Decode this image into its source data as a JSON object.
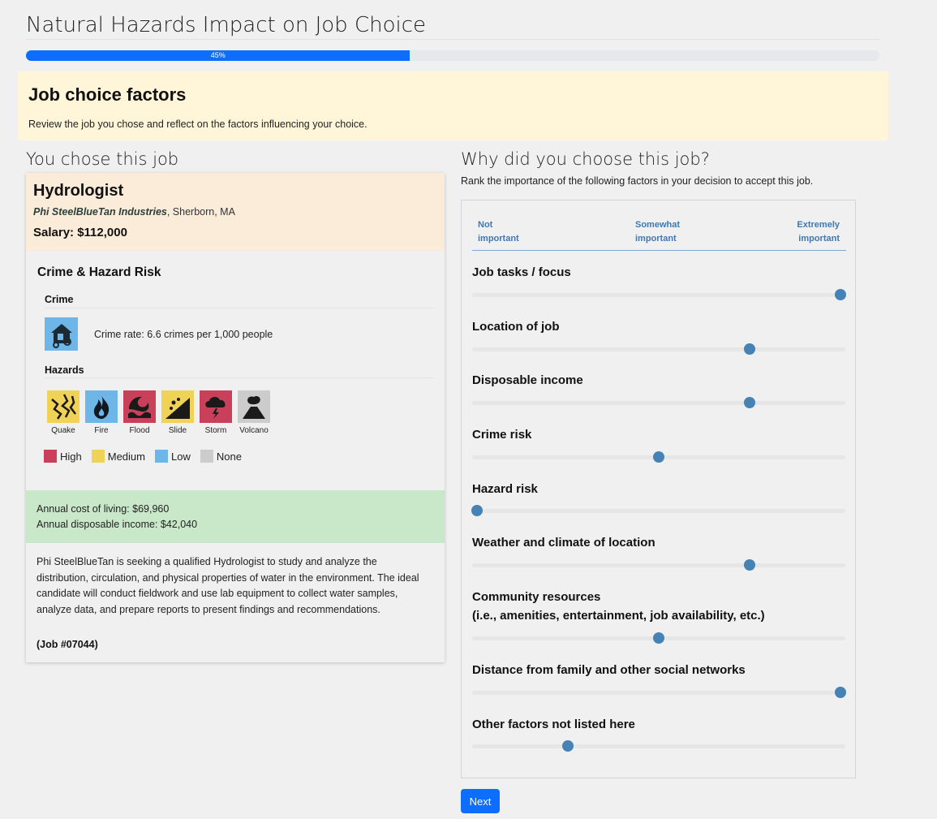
{
  "page": {
    "title": "Natural Hazards Impact on Job Choice"
  },
  "progress": {
    "value": 45,
    "label": "45%"
  },
  "banner": {
    "heading": "Job choice factors",
    "text": "Review the job you chose and reflect on the factors influencing your choice."
  },
  "job": {
    "section_heading": "You chose this job",
    "title": "Hydrologist",
    "company": "Phi SteelBlueTan Industries",
    "location": ", Sherborn, MA",
    "salary": "Salary: $112,000",
    "risk_heading": "Crime & Hazard Risk",
    "crime_heading": "Crime",
    "crime_icon": "house-burglary-icon",
    "crime_text": "Crime rate: 6.6 crimes per 1,000 people",
    "hazards_heading": "Hazards",
    "hazards": [
      {
        "label": "Quake",
        "level": "Medium",
        "icon": "earthquake-icon"
      },
      {
        "label": "Fire",
        "level": "Low",
        "icon": "fire-icon"
      },
      {
        "label": "Flood",
        "level": "High",
        "icon": "flood-wave-icon"
      },
      {
        "label": "Slide",
        "level": "Medium",
        "icon": "landslide-icon"
      },
      {
        "label": "Storm",
        "level": "High",
        "icon": "storm-cloud-icon"
      },
      {
        "label": "Volcano",
        "level": "None",
        "icon": "volcano-icon"
      }
    ],
    "legend": [
      {
        "label": "High",
        "color": "#c9405a"
      },
      {
        "label": "Medium",
        "color": "#f0d256"
      },
      {
        "label": "Low",
        "color": "#6fb6e8"
      },
      {
        "label": "None",
        "color": "#cccccc"
      }
    ],
    "cost_of_living": "Annual cost of living: $69,960",
    "disposable_income": "Annual disposable income: $42,040",
    "description": "Phi SteelBlueTan is seeking a qualified Hydrologist to study and analyze the distribution, circulation, and physical properties of water in the environment. The ideal candidate will conduct fieldwork and use lab equipment to collect water samples, analyze data, and prepare reports to present findings and recommendations.",
    "job_id": "(Job #07044)"
  },
  "ranking": {
    "heading": "Why did you choose this job?",
    "instructions": "Rank the importance of the following factors in your decision to accept this job.",
    "scale": {
      "low_line1": "Not",
      "low_line2": "important",
      "mid_line1": "Somewhat",
      "mid_line2": "important",
      "high_line1": "Extremely",
      "high_line2": "important"
    },
    "factors": [
      {
        "label": "Job tasks / focus",
        "label2": "",
        "value": 1.0
      },
      {
        "label": "Location of job",
        "label2": "",
        "value": 0.75
      },
      {
        "label": "Disposable income",
        "label2": "",
        "value": 0.75
      },
      {
        "label": "Crime risk",
        "label2": "",
        "value": 0.5
      },
      {
        "label": "Hazard risk",
        "label2": "",
        "value": 0.0
      },
      {
        "label": "Weather and climate of location",
        "label2": "",
        "value": 0.75
      },
      {
        "label": "Community resources",
        "label2": "(i.e., amenities, entertainment, job availability, etc.)",
        "value": 0.5
      },
      {
        "label": "Distance from family and other social networks",
        "label2": "",
        "value": 1.0
      },
      {
        "label": "Other factors not listed here",
        "label2": "",
        "value": 0.25
      }
    ],
    "slider_color": "#4682b4"
  },
  "next_label": "Next"
}
